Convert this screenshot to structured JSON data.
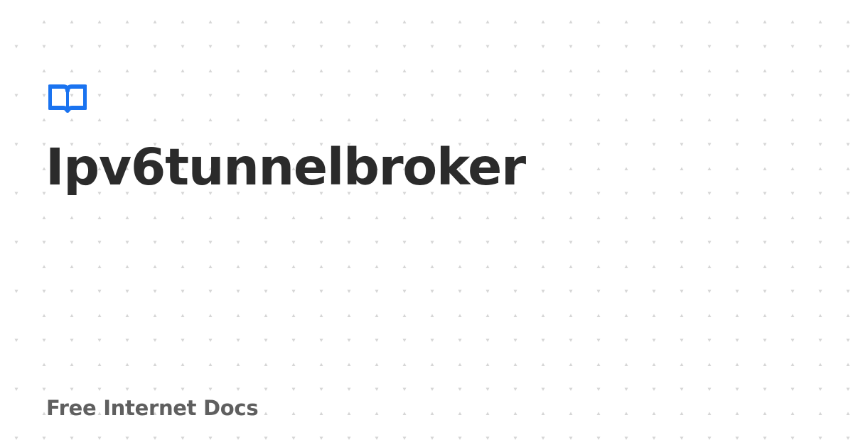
{
  "brand": {
    "icon": "open-book-icon",
    "accent_color": "#1a73f0"
  },
  "page": {
    "title": "Ipv6tunnelbroker",
    "site_name": "Free Internet Docs"
  },
  "background": {
    "pattern": "triangle-dot-grid",
    "color": "#ffffff",
    "pattern_color": "#d6d6d6"
  }
}
